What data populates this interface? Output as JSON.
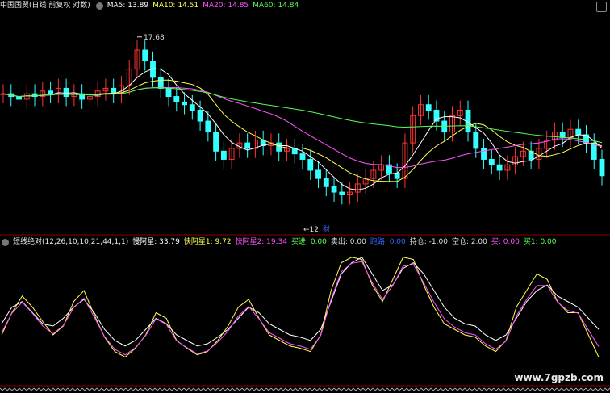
{
  "main_panel": {
    "title": "中国国贸(日线 前复权 对数)",
    "ma5": "MA5: 13.89",
    "ma10": "MA10: 14.51",
    "ma20": "MA20: 14.85",
    "ma60": "MA60: 14.84",
    "colors": {
      "ma5": "#ffffff",
      "ma10": "#ffff55",
      "ma20": "#ff55ff",
      "ma60": "#55ff55",
      "up": "#ff3333",
      "down": "#33ffff"
    },
    "high_marker": "17.68",
    "low_marker": "12.",
    "marker_label": "财"
  },
  "indicator_panel": {
    "title": "短线绝对(12,26,10,10,21,44,1,1)",
    "slow": "慢阿星: 33.79",
    "fast1": "快阿星1: 9.72",
    "fast2": "快阿星2: 19.34",
    "buy_in": "买进: 0.00",
    "sell_out": "卖出: 0.00",
    "run": "跑路: 0.00",
    "hold": "持仓: -1.00",
    "empty": "空仓: 2.00",
    "buy": "买: 0.00",
    "buy1": "买1: 0.00",
    "colors": {
      "slow": "#ffffff",
      "fast1": "#ffff55",
      "fast2": "#ff55ff",
      "buy_in": "#55ff55",
      "run": "#3366ff"
    }
  },
  "watermark": "www.7gpzb.com",
  "chart_data": {
    "type": "candlestick",
    "ma_ylim": [
      11.5,
      18.5
    ],
    "close_series": [
      15.6,
      15.5,
      15.4,
      15.6,
      15.5,
      15.7,
      15.6,
      15.8,
      15.5,
      15.6,
      15.4,
      15.5,
      15.7,
      15.8,
      15.6,
      15.9,
      16.5,
      17.2,
      16.8,
      16.2,
      15.8,
      15.5,
      15.3,
      15.2,
      15.0,
      14.6,
      14.2,
      13.5,
      13.2,
      13.6,
      13.8,
      13.6,
      13.9,
      13.7,
      13.8,
      13.5,
      13.6,
      13.4,
      13.2,
      12.8,
      12.5,
      12.2,
      12.0,
      11.9,
      12.0,
      12.3,
      12.5,
      12.8,
      13.0,
      12.7,
      12.5,
      13.8,
      14.8,
      15.2,
      15.0,
      14.6,
      14.2,
      14.8,
      15.0,
      14.2,
      13.6,
      13.2,
      13.0,
      12.8,
      13.0,
      13.3,
      13.5,
      13.2,
      13.6,
      13.9,
      14.2,
      14.0,
      14.3,
      14.1,
      13.8,
      13.2,
      12.6
    ],
    "indicator_ylim": [
      -10,
      110
    ],
    "slow": [
      40,
      55,
      60,
      50,
      40,
      38,
      45,
      55,
      62,
      50,
      35,
      25,
      20,
      25,
      35,
      45,
      40,
      30,
      25,
      20,
      22,
      28,
      35,
      45,
      55,
      50,
      40,
      35,
      30,
      28,
      25,
      35,
      60,
      85,
      95,
      100,
      85,
      70,
      75,
      90,
      95,
      85,
      70,
      55,
      45,
      40,
      38,
      30,
      25,
      30,
      45,
      60,
      70,
      75,
      65,
      60,
      55,
      45,
      35
    ],
    "fast": [
      30,
      50,
      65,
      55,
      42,
      30,
      38,
      60,
      70,
      48,
      28,
      15,
      10,
      18,
      30,
      50,
      45,
      25,
      18,
      12,
      15,
      25,
      38,
      55,
      62,
      45,
      30,
      25,
      20,
      18,
      15,
      30,
      70,
      95,
      100,
      98,
      75,
      60,
      80,
      100,
      98,
      75,
      55,
      40,
      35,
      30,
      28,
      20,
      15,
      25,
      55,
      70,
      85,
      80,
      60,
      50,
      50,
      30,
      10
    ]
  }
}
